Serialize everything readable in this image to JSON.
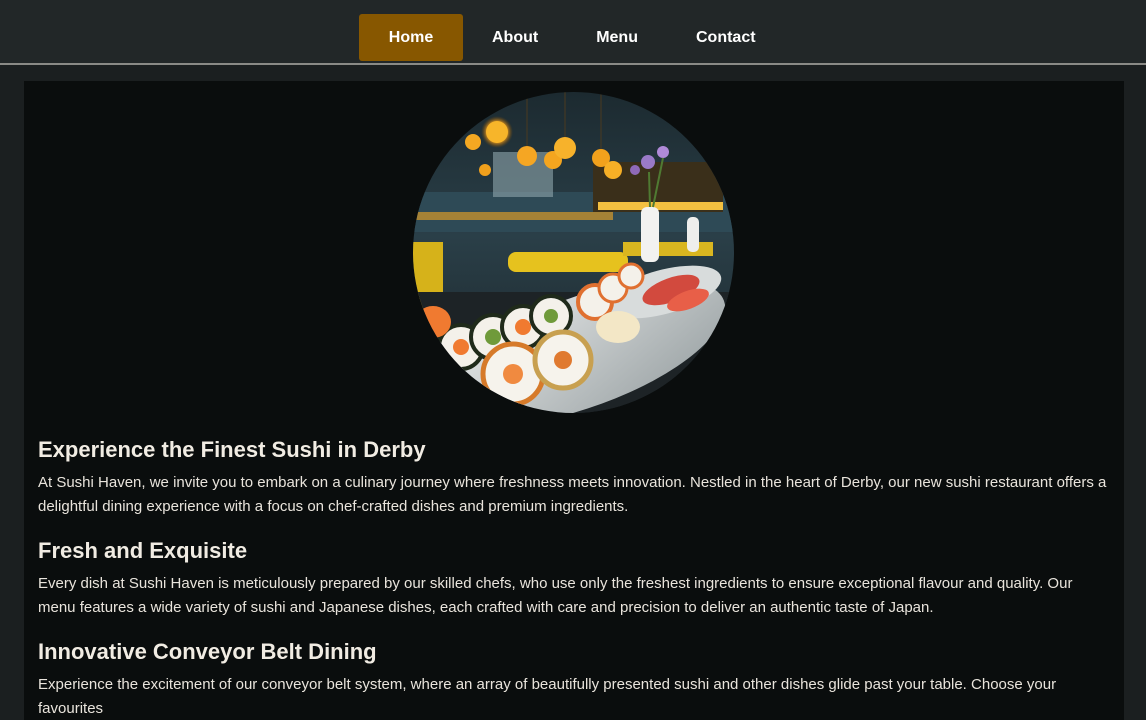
{
  "nav": {
    "items": [
      {
        "label": "Home",
        "active": true
      },
      {
        "label": "About",
        "active": false
      },
      {
        "label": "Menu",
        "active": false
      },
      {
        "label": "Contact",
        "active": false
      }
    ]
  },
  "colors": {
    "nav_active": "#875700",
    "nav_bg": "#222728",
    "page_bg": "#1b1f20",
    "main_bg": "#0a0d0d",
    "text": "#e9e4dc"
  },
  "hero": {
    "image": "sushi-restaurant-photo"
  },
  "sections": [
    {
      "heading": "Experience the Finest Sushi in Derby",
      "body": "At Sushi Haven, we invite you to embark on a culinary journey where freshness meets innovation. Nestled in the heart of Derby, our new sushi restaurant offers a delightful dining experience with a focus on chef-crafted dishes and premium ingredients."
    },
    {
      "heading": "Fresh and Exquisite",
      "body": "Every dish at Sushi Haven is meticulously prepared by our skilled chefs, who use only the freshest ingredients to ensure exceptional flavour and quality. Our menu features a wide variety of sushi and Japanese dishes, each crafted with care and precision to deliver an authentic taste of Japan."
    },
    {
      "heading": "Innovative Conveyor Belt Dining",
      "body": "Experience the excitement of our conveyor belt system, where an array of beautifully presented sushi and other dishes glide past your table. Choose your favourites"
    }
  ]
}
